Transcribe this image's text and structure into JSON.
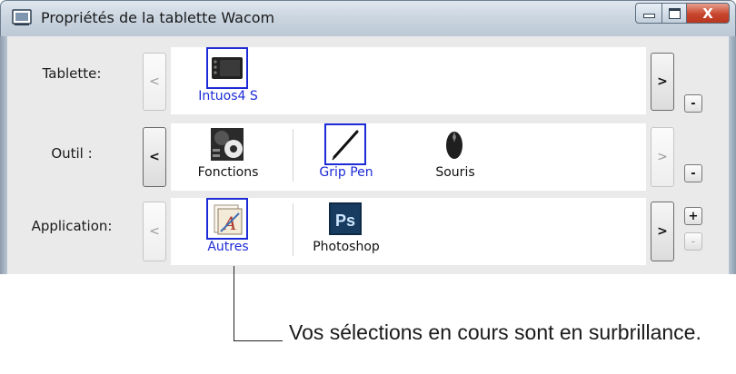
{
  "window": {
    "title": "Propriétés de la tablette Wacom",
    "icon": "tablet-app-icon",
    "controls": {
      "minimize": "minimize-icon",
      "maximize": "maximize-icon",
      "close": "X"
    }
  },
  "rows": {
    "tablet": {
      "label": "Tablette:",
      "prev": "<",
      "next": ">",
      "remove": "-",
      "items": [
        {
          "label": "Intuos4 S",
          "icon": "tablet-icon",
          "selected": true
        }
      ]
    },
    "tool": {
      "label": "Outil :",
      "prev": "<",
      "next": ">",
      "remove": "-",
      "items": [
        {
          "label": "Fonctions",
          "icon": "functions-icon",
          "selected": false
        },
        {
          "label": "Grip Pen",
          "icon": "pen-icon",
          "selected": true
        },
        {
          "label": "Souris",
          "icon": "mouse-icon",
          "selected": false
        }
      ]
    },
    "application": {
      "label": "Application:",
      "prev": "<",
      "next": ">",
      "add": "+",
      "remove": "-",
      "items": [
        {
          "label": "Autres",
          "icon": "all-apps-icon",
          "selected": true
        },
        {
          "label": "Photoshop",
          "icon": "photoshop-icon",
          "selected": false,
          "icon_text": "Ps"
        }
      ]
    }
  },
  "callout": {
    "text": "Vos sélections en cours sont en surbrillance."
  },
  "colors": {
    "selection": "#1d2bd6",
    "panel": "#eaeaea",
    "strip": "#ffffff"
  }
}
